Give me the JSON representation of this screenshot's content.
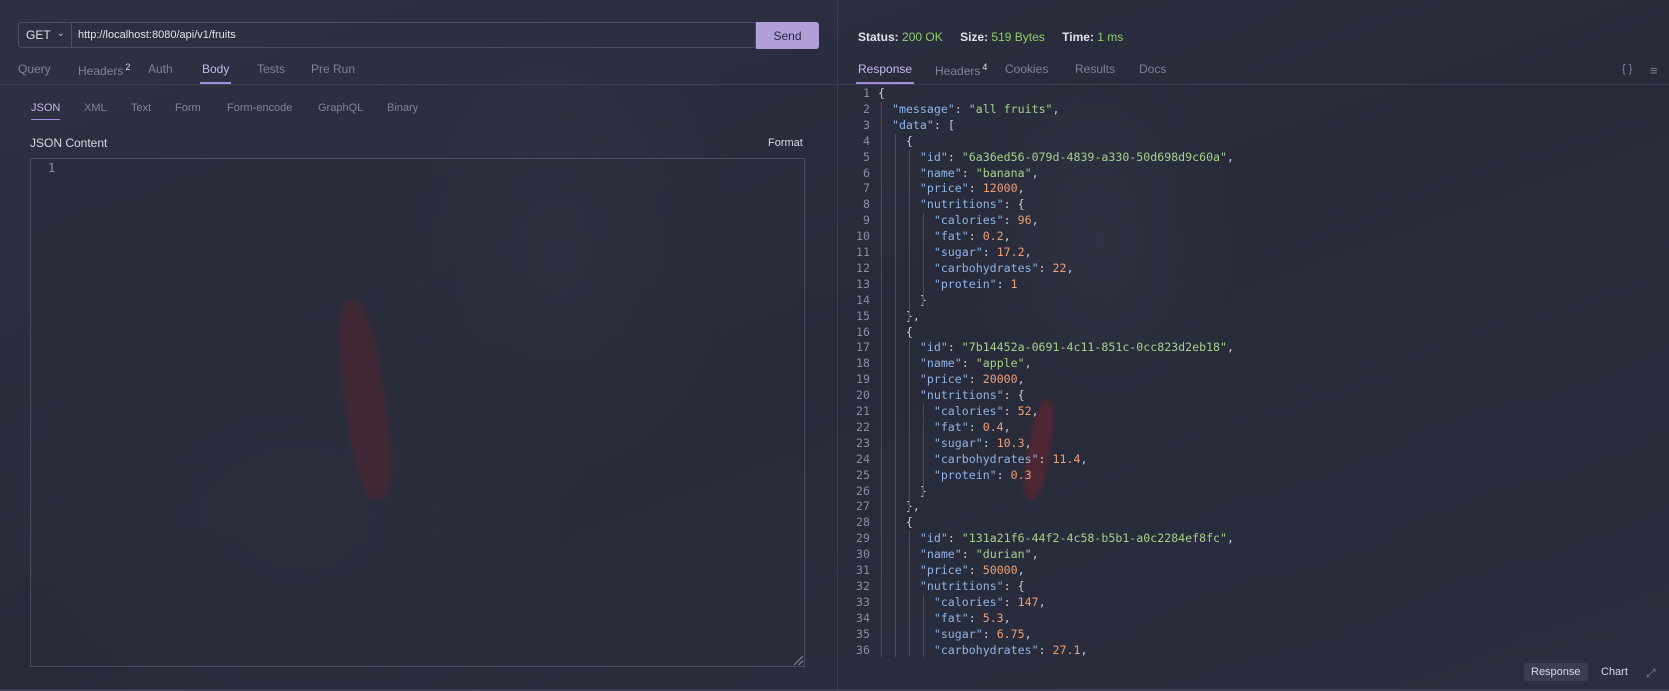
{
  "request": {
    "method": "GET",
    "url": "http://localhost:8080/api/v1/fruits",
    "send_label": "Send",
    "tabs": [
      {
        "label": "Query"
      },
      {
        "label": "Headers",
        "badge": "2"
      },
      {
        "label": "Auth"
      },
      {
        "label": "Body"
      },
      {
        "label": "Tests"
      },
      {
        "label": "Pre Run"
      }
    ],
    "active_tab": "Body",
    "body_tabs": [
      "JSON",
      "XML",
      "Text",
      "Form",
      "Form-encode",
      "GraphQL",
      "Binary"
    ],
    "active_body_tab": "JSON",
    "content_label": "JSON Content",
    "format_label": "Format",
    "editor_line": "1"
  },
  "response": {
    "status_label": "Status:",
    "status_value": "200 OK",
    "size_label": "Size:",
    "size_value": "519 Bytes",
    "time_label": "Time:",
    "time_value": "1 ms",
    "tabs": [
      {
        "label": "Response"
      },
      {
        "label": "Headers",
        "badge": "4"
      },
      {
        "label": "Cookies"
      },
      {
        "label": "Results"
      },
      {
        "label": "Docs"
      }
    ],
    "active_tab": "Response",
    "code_lines": [
      "{",
      "  \"message\": \"all fruits\",",
      "  \"data\": [",
      "    {",
      "      \"id\": \"6a36ed56-079d-4839-a330-50d698d9c60a\",",
      "      \"name\": \"banana\",",
      "      \"price\": 12000,",
      "      \"nutritions\": {",
      "        \"calories\": 96,",
      "        \"fat\": 0.2,",
      "        \"sugar\": 17.2,",
      "        \"carbohydrates\": 22,",
      "        \"protein\": 1",
      "      }",
      "    },",
      "    {",
      "      \"id\": \"7b14452a-0691-4c11-851c-0cc823d2eb18\",",
      "      \"name\": \"apple\",",
      "      \"price\": 20000,",
      "      \"nutritions\": {",
      "        \"calories\": 52,",
      "        \"fat\": 0.4,",
      "        \"sugar\": 10.3,",
      "        \"carbohydrates\": 11.4,",
      "        \"protein\": 0.3",
      "      }",
      "    },",
      "    {",
      "      \"id\": \"131a21f6-44f2-4c58-b5b1-a0c2284ef8fc\",",
      "      \"name\": \"durian\",",
      "      \"price\": 50000,",
      "      \"nutritions\": {",
      "        \"calories\": 147,",
      "        \"fat\": 5.3,",
      "        \"sugar\": 6.75,",
      "        \"carbohydrates\": 27.1,"
    ],
    "bottom_buttons": [
      "Response",
      "Chart"
    ],
    "icons": [
      "braces-icon",
      "menu-icon",
      "expand-icon"
    ]
  },
  "colors": {
    "accent": "#a68fe3",
    "send_bg": "#b09fd8",
    "status_ok": "#8fcf6a",
    "json_key": "#8fb4e6",
    "json_string": "#a6d189",
    "json_number": "#ef9f76"
  }
}
